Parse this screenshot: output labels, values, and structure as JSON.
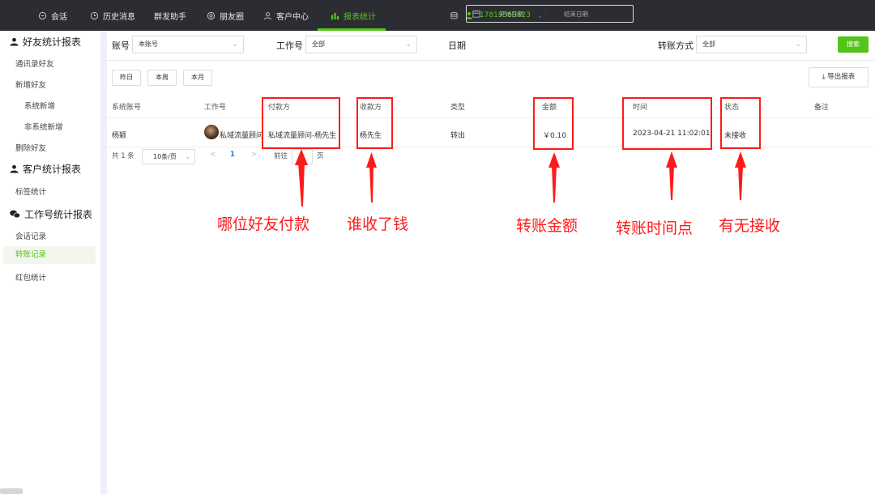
{
  "topbar": {
    "tabs": [
      {
        "label": "会话",
        "icon": "chat-icon"
      },
      {
        "label": "历史消息",
        "icon": "clock-icon"
      },
      {
        "label": "群发助手",
        "icon": ""
      },
      {
        "label": "朋友圈",
        "icon": "aperture-icon"
      },
      {
        "label": "客户中心",
        "icon": "user-icon"
      },
      {
        "label": "报表统计",
        "icon": "bar-chart-icon"
      }
    ],
    "account": "17819569823"
  },
  "sidebar": {
    "sections": [
      {
        "title": "好友统计报表",
        "icon": "person-icon"
      },
      {
        "title": "客户统计报表",
        "icon": "person-icon"
      },
      {
        "title": "工作号统计报表",
        "icon": "wechat-icon"
      }
    ],
    "items": [
      "通讯录好友",
      "新增好友",
      "系统新增",
      "非系统新增",
      "删除好友",
      "标签统计",
      "会话记录",
      "转账记录",
      "红包统计"
    ]
  },
  "filters": {
    "account_label": "账号",
    "account_value": "本账号",
    "worker_label": "工作号",
    "worker_value": "全部",
    "date_label": "日期",
    "date_start_placeholder": "开始日期",
    "date_sep": "至",
    "date_end_placeholder": "结束日期",
    "transfer_label": "转账方式",
    "transfer_value": "全部",
    "search": "搜索"
  },
  "quick": [
    "昨日",
    "本周",
    "本月"
  ],
  "export": "导出报表",
  "table": {
    "headers": [
      "系统账号",
      "工作号",
      "付款方",
      "收款方",
      "类型",
      "金额",
      "时间",
      "状态",
      "备注"
    ],
    "rows": [
      {
        "system_account": "杨颖",
        "worker": "私域流量顾问",
        "payer": "私域流量顾问-杨先生",
        "payee": "杨先生",
        "type": "转出",
        "amount": "￥0.10",
        "time": "2023-04-21 11:02:01",
        "status": "未接收",
        "remark": ""
      }
    ]
  },
  "pagination": {
    "total": "共 1 条",
    "page_size": "10条/页",
    "current": "1",
    "goto_prefix": "前往",
    "goto_value": "1",
    "goto_suffix": "页"
  },
  "annotations": [
    "哪位好友付款",
    "谁收了钱",
    "转账金额",
    "转账时间点",
    "有无接收"
  ],
  "colors": {
    "accent": "#52c41a",
    "annotation": "#ff1a1a",
    "topbar": "#2b2d33"
  }
}
